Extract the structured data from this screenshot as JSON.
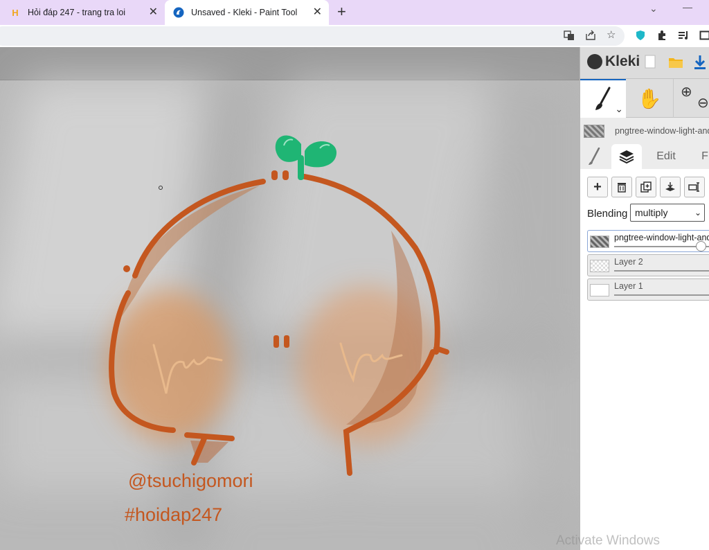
{
  "browser": {
    "tabs": [
      {
        "title": "Hỏi đáp 247 - trang tra loi",
        "favicon": "H",
        "active": false
      },
      {
        "title": "Unsaved - Kleki - Paint Tool",
        "favicon": "K",
        "active": true
      }
    ]
  },
  "app": {
    "name": "Kleki",
    "file_name": "pngtree-window-light-and-shadow-overlay",
    "side_tabs": [
      "Edit",
      "F"
    ],
    "blending_label": "Blending",
    "blending_value": "multiply",
    "layers": [
      {
        "name": "pngtree-window-light-and-shadow",
        "active": true
      },
      {
        "name": "Layer 2",
        "active": false
      },
      {
        "name": "Layer 1",
        "active": false
      }
    ]
  },
  "canvas": {
    "caption_handle": "@tsuchigomori",
    "caption_tag": "#hoidap247"
  },
  "os": {
    "watermark": "Activate Windows"
  },
  "colors": {
    "tab_bar": "#e9d8f8",
    "stroke": "#c4571f",
    "sprout": "#1fb574",
    "kleki_blue": "#1565c0",
    "folder": "#f3b51b"
  }
}
